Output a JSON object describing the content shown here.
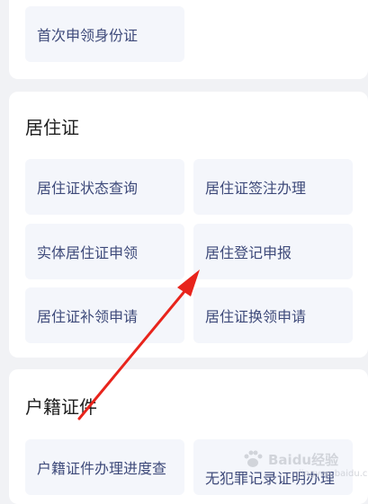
{
  "top_section": {
    "item": "首次申领身份证"
  },
  "residence_section": {
    "title": "居住证",
    "items": [
      "居住证状态查询",
      "居住证签注办理",
      "实体居住证申领",
      "居住登记申报",
      "居住证补领申请",
      "居住证换领申请"
    ]
  },
  "household_section": {
    "title": "户籍证件",
    "items": [
      "户籍证件办理进度查",
      "无犯罪记录证明办理"
    ]
  },
  "watermark": {
    "brand": "Baidu经验",
    "url": "jingyan.baidu.com"
  },
  "colors": {
    "background": "#f1f2f5",
    "card": "#ffffff",
    "item_bg": "#f4f6fb",
    "item_text": "#3e4a7a",
    "arrow": "#e8241c"
  }
}
